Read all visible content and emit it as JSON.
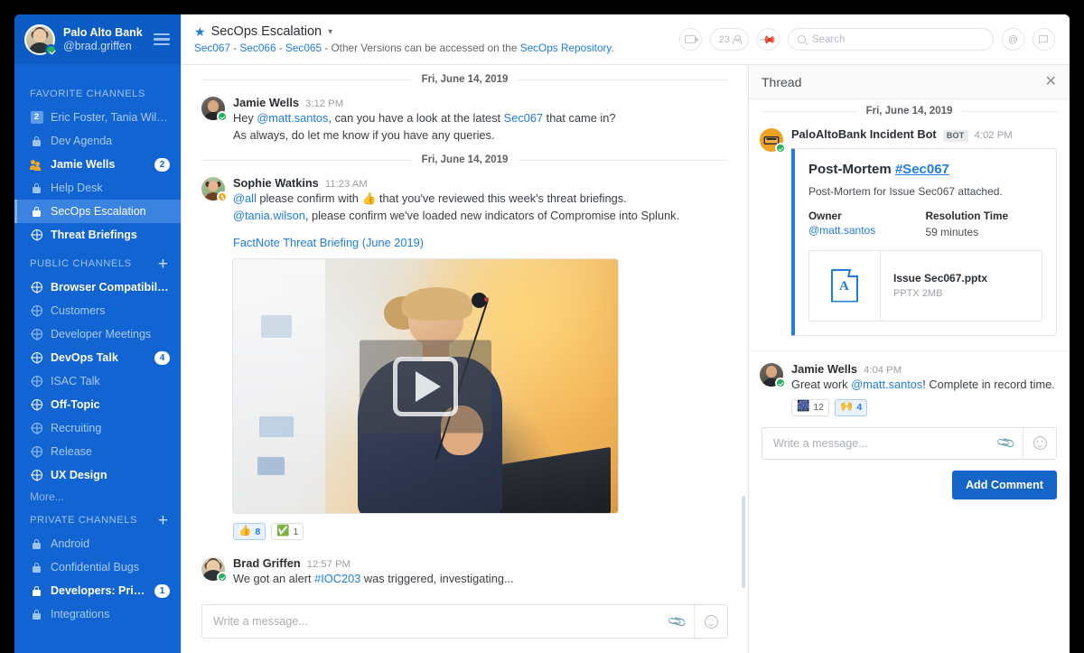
{
  "sidebar": {
    "org_name": "Palo Alto Bank",
    "username": "@brad.griffen",
    "sections": [
      {
        "label": "FAVORITE CHANNELS",
        "has_plus": false,
        "items": [
          {
            "label": "Eric Foster, Tania Wilson",
            "icon": "square-badge",
            "sq": "2",
            "state": "dim"
          },
          {
            "label": "Dev Agenda",
            "icon": "lock-icon",
            "state": "dim"
          },
          {
            "label": "Jamie Wells",
            "icon": "people-icon",
            "state": "unread",
            "badge": "2"
          },
          {
            "label": "Help Desk",
            "icon": "lock-icon",
            "state": "dim"
          },
          {
            "label": "SecOps Escalation",
            "icon": "lock-icon",
            "state": "selected"
          },
          {
            "label": "Threat Briefings",
            "icon": "globe-icon",
            "state": "unread"
          }
        ]
      },
      {
        "label": "PUBLIC CHANNELS",
        "has_plus": true,
        "items": [
          {
            "label": "Browser Compatibility",
            "icon": "globe-icon",
            "state": "unread"
          },
          {
            "label": "Customers",
            "icon": "globe-icon",
            "state": "dim"
          },
          {
            "label": "Developer Meetings",
            "icon": "globe-icon",
            "state": "dim"
          },
          {
            "label": "DevOps Talk",
            "icon": "globe-icon",
            "state": "unread",
            "badge": "4"
          },
          {
            "label": "ISAC Talk",
            "icon": "globe-icon",
            "state": "dim"
          },
          {
            "label": "Off-Topic",
            "icon": "globe-icon",
            "state": "unread"
          },
          {
            "label": "Recruiting",
            "icon": "globe-icon",
            "state": "dim"
          },
          {
            "label": "Release",
            "icon": "globe-icon",
            "state": "dim"
          },
          {
            "label": "UX Design",
            "icon": "globe-icon",
            "state": "unread"
          }
        ],
        "more_label": "More..."
      },
      {
        "label": "PRIVATE CHANNELS",
        "has_plus": true,
        "items": [
          {
            "label": "Android",
            "icon": "lock-icon",
            "state": "dim"
          },
          {
            "label": "Confidential Bugs",
            "icon": "lock-icon",
            "state": "dim"
          },
          {
            "label": "Developers: Private",
            "icon": "lock-icon",
            "state": "unread",
            "badge": "1"
          },
          {
            "label": "Integrations",
            "icon": "lock-icon",
            "state": "dim"
          }
        ]
      }
    ]
  },
  "topbar": {
    "channel_name": "SecOps Escalation",
    "subtitle_links": [
      "Sec067",
      "Sec066",
      "Sec065"
    ],
    "subtitle_text": "- Other Versions can be accessed on the",
    "subtitle_repo": "SecOps Repository",
    "subtitle_end": ".",
    "member_count": "23",
    "search_placeholder": "Search"
  },
  "messages": {
    "day_1": "Fri, June 14, 2019",
    "day_2": "Fri, June 14, 2019",
    "m1": {
      "author": "Jamie Wells",
      "time": "3:12 PM",
      "line1_pre": "Hey ",
      "line1_mention": "@matt.santos",
      "line1_mid": ", can you have a look at the latest ",
      "line1_link": "Sec067",
      "line1_end": " that came in?",
      "line2": "As always, do let me know if you have any queries."
    },
    "m2": {
      "author": "Sophie Watkins",
      "time": "11:23 AM",
      "line1_mention": "@all",
      "line1_mid": " please confirm with ",
      "line1_emoji": "👍",
      "line1_end": " that you've reviewed this week's threat briefings.",
      "line2_mention": "@tania.wilson",
      "line2_end": ", please confirm we've loaded new indicators of Compromise into Splunk.",
      "video_link": "FactNote Threat Briefing (June 2019)",
      "reactions": [
        {
          "emoji": "👍",
          "count": "8",
          "active": true
        },
        {
          "emoji": "✅",
          "count": "1",
          "active": false
        }
      ]
    },
    "m3": {
      "author": "Brad Griffen",
      "time": "12:57 PM",
      "line1_pre": "We got an alert ",
      "line1_link": "#IOC203",
      "line1_end": " was triggered, investigating..."
    },
    "composer_placeholder": "Write a message..."
  },
  "thread": {
    "title": "Thread",
    "day": "Fri, June 14, 2019",
    "bot": {
      "author": "PaloAltoBank Incident Bot",
      "tag": "BOT",
      "time": "4:02 PM",
      "card": {
        "heading": "Post-Mortem ",
        "heading_id": "#Sec067",
        "description": "Post-Mortem for Issue Sec067 attached.",
        "owner_label": "Owner",
        "owner_value": "@matt.santos",
        "resolution_label": "Resolution Time",
        "resolution_value": "59 minutes",
        "file_name": "Issue Sec067.pptx",
        "file_meta": "PPTX 2MB",
        "file_glyph": "A"
      }
    },
    "reply": {
      "author": "Jamie Wells",
      "time": "4:04 PM",
      "text_pre": "Great work ",
      "mention": "@matt.santos",
      "text_end": "! Complete in record time.",
      "reactions": [
        {
          "emoji": "🎆",
          "count": "12",
          "active": false
        },
        {
          "emoji": "🙌",
          "count": "4",
          "active": true
        }
      ]
    },
    "composer_placeholder": "Write a message...",
    "add_comment_label": "Add Comment"
  },
  "colors": {
    "sidebar_bg": "#1264d2",
    "sidebar_header_bg": "#0d5bc4",
    "selected_bg": "#3b83e0",
    "accent_blue": "#1f7de0",
    "button_blue": "#1565c9",
    "online_green": "#27ae60",
    "away_orange": "#f5a623"
  }
}
